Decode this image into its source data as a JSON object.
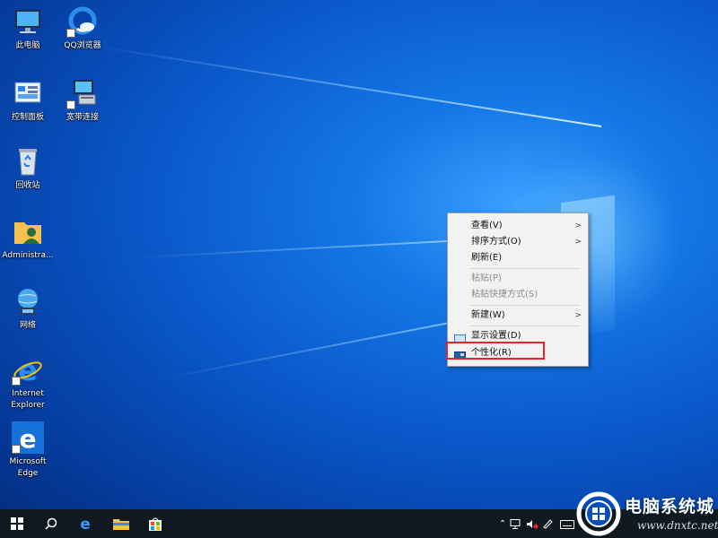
{
  "desktop": {
    "icons": [
      {
        "label": "此电脑"
      },
      {
        "label": "QQ浏览器"
      },
      {
        "label": "控制面板"
      },
      {
        "label": "宽带连接"
      },
      {
        "label": "回收站"
      },
      {
        "label": "Administra..."
      },
      {
        "label": "网络"
      },
      {
        "label": "Internet\nExplorer"
      },
      {
        "label": "Microsoft\nEdge"
      }
    ]
  },
  "context_menu": {
    "items": [
      {
        "label": "查看(V)",
        "submenu": true,
        "enabled": true
      },
      {
        "label": "排序方式(O)",
        "submenu": true,
        "enabled": true
      },
      {
        "label": "刷新(E)",
        "submenu": false,
        "enabled": true
      },
      {
        "label": "粘贴(P)",
        "submenu": false,
        "enabled": false
      },
      {
        "label": "粘贴快捷方式(S)",
        "submenu": false,
        "enabled": false
      },
      {
        "label": "新建(W)",
        "submenu": true,
        "enabled": true
      },
      {
        "label": "显示设置(D)",
        "submenu": false,
        "enabled": true,
        "icon": "display-settings-icon"
      },
      {
        "label": "个性化(R)",
        "submenu": false,
        "enabled": true,
        "icon": "personalize-icon",
        "highlighted": true
      }
    ],
    "highlight_color": "#e5262b"
  },
  "taskbar": {
    "buttons": [
      "start-button",
      "search-button",
      "edge-button",
      "file-explorer-button",
      "store-button"
    ]
  },
  "watermark": {
    "brand": "电脑系统城",
    "url": "www.dnxtc.net"
  },
  "colors": {
    "desktop_accent": "#0a56c8",
    "taskbar": "#101820"
  }
}
